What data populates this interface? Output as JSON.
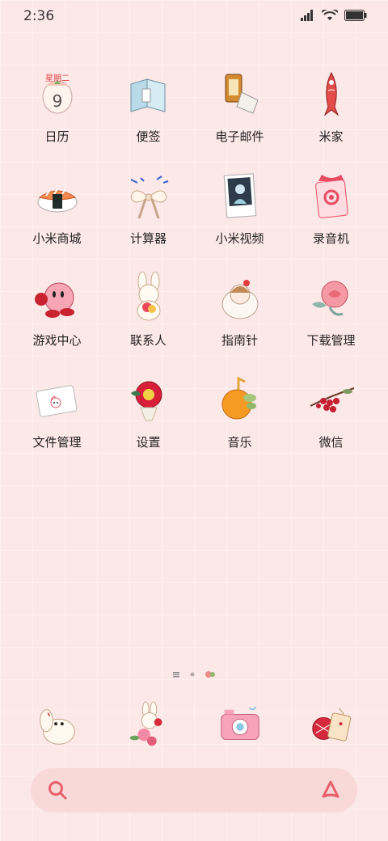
{
  "status_bar": {
    "time": "2:36"
  },
  "grid": {
    "apps": [
      {
        "label": "日历",
        "icon": "calendar-peach-icon",
        "icon_text": "星期二",
        "date": "9"
      },
      {
        "label": "便签",
        "icon": "book-icon"
      },
      {
        "label": "电子邮件",
        "icon": "film-roll-icon"
      },
      {
        "label": "米家",
        "icon": "koi-fish-icon"
      },
      {
        "label": "小米商城",
        "icon": "sushi-icon"
      },
      {
        "label": "计算器",
        "icon": "bow-icon"
      },
      {
        "label": "小米视频",
        "icon": "photo-card-icon"
      },
      {
        "label": "录音机",
        "icon": "charm-icon"
      },
      {
        "label": "游戏中心",
        "icon": "kirby-icon"
      },
      {
        "label": "联系人",
        "icon": "bunny-icon"
      },
      {
        "label": "指南针",
        "icon": "girl-icon"
      },
      {
        "label": "下载管理",
        "icon": "rose-icon"
      },
      {
        "label": "文件管理",
        "icon": "kitty-card-icon"
      },
      {
        "label": "设置",
        "icon": "camellia-icon"
      },
      {
        "label": "音乐",
        "icon": "orange-icon"
      },
      {
        "label": "微信",
        "icon": "berries-icon"
      }
    ]
  },
  "dock": [
    {
      "icon": "puppy-icon"
    },
    {
      "icon": "bunny-flower-icon"
    },
    {
      "icon": "camera-icon"
    },
    {
      "icon": "tag-icon"
    }
  ],
  "search": {
    "left_icon": "search-icon",
    "right_icon": "assistant-icon"
  },
  "colors": {
    "background": "#fde8e8",
    "search_bg": "#f9d8d8",
    "accent": "#e65f6a"
  }
}
